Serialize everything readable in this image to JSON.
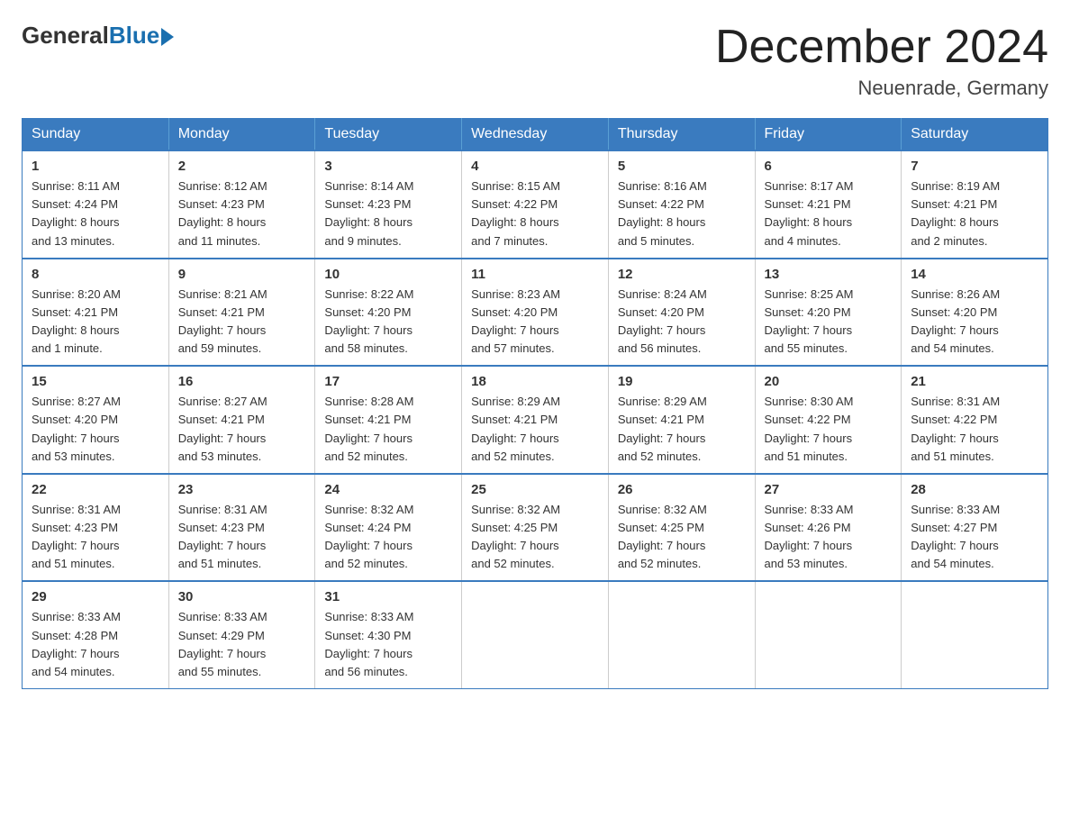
{
  "logo": {
    "general": "General",
    "blue": "Blue"
  },
  "title": "December 2024",
  "subtitle": "Neuenrade, Germany",
  "days_of_week": [
    "Sunday",
    "Monday",
    "Tuesday",
    "Wednesday",
    "Thursday",
    "Friday",
    "Saturday"
  ],
  "weeks": [
    [
      {
        "day": "1",
        "info": "Sunrise: 8:11 AM\nSunset: 4:24 PM\nDaylight: 8 hours\nand 13 minutes."
      },
      {
        "day": "2",
        "info": "Sunrise: 8:12 AM\nSunset: 4:23 PM\nDaylight: 8 hours\nand 11 minutes."
      },
      {
        "day": "3",
        "info": "Sunrise: 8:14 AM\nSunset: 4:23 PM\nDaylight: 8 hours\nand 9 minutes."
      },
      {
        "day": "4",
        "info": "Sunrise: 8:15 AM\nSunset: 4:22 PM\nDaylight: 8 hours\nand 7 minutes."
      },
      {
        "day": "5",
        "info": "Sunrise: 8:16 AM\nSunset: 4:22 PM\nDaylight: 8 hours\nand 5 minutes."
      },
      {
        "day": "6",
        "info": "Sunrise: 8:17 AM\nSunset: 4:21 PM\nDaylight: 8 hours\nand 4 minutes."
      },
      {
        "day": "7",
        "info": "Sunrise: 8:19 AM\nSunset: 4:21 PM\nDaylight: 8 hours\nand 2 minutes."
      }
    ],
    [
      {
        "day": "8",
        "info": "Sunrise: 8:20 AM\nSunset: 4:21 PM\nDaylight: 8 hours\nand 1 minute."
      },
      {
        "day": "9",
        "info": "Sunrise: 8:21 AM\nSunset: 4:21 PM\nDaylight: 7 hours\nand 59 minutes."
      },
      {
        "day": "10",
        "info": "Sunrise: 8:22 AM\nSunset: 4:20 PM\nDaylight: 7 hours\nand 58 minutes."
      },
      {
        "day": "11",
        "info": "Sunrise: 8:23 AM\nSunset: 4:20 PM\nDaylight: 7 hours\nand 57 minutes."
      },
      {
        "day": "12",
        "info": "Sunrise: 8:24 AM\nSunset: 4:20 PM\nDaylight: 7 hours\nand 56 minutes."
      },
      {
        "day": "13",
        "info": "Sunrise: 8:25 AM\nSunset: 4:20 PM\nDaylight: 7 hours\nand 55 minutes."
      },
      {
        "day": "14",
        "info": "Sunrise: 8:26 AM\nSunset: 4:20 PM\nDaylight: 7 hours\nand 54 minutes."
      }
    ],
    [
      {
        "day": "15",
        "info": "Sunrise: 8:27 AM\nSunset: 4:20 PM\nDaylight: 7 hours\nand 53 minutes."
      },
      {
        "day": "16",
        "info": "Sunrise: 8:27 AM\nSunset: 4:21 PM\nDaylight: 7 hours\nand 53 minutes."
      },
      {
        "day": "17",
        "info": "Sunrise: 8:28 AM\nSunset: 4:21 PM\nDaylight: 7 hours\nand 52 minutes."
      },
      {
        "day": "18",
        "info": "Sunrise: 8:29 AM\nSunset: 4:21 PM\nDaylight: 7 hours\nand 52 minutes."
      },
      {
        "day": "19",
        "info": "Sunrise: 8:29 AM\nSunset: 4:21 PM\nDaylight: 7 hours\nand 52 minutes."
      },
      {
        "day": "20",
        "info": "Sunrise: 8:30 AM\nSunset: 4:22 PM\nDaylight: 7 hours\nand 51 minutes."
      },
      {
        "day": "21",
        "info": "Sunrise: 8:31 AM\nSunset: 4:22 PM\nDaylight: 7 hours\nand 51 minutes."
      }
    ],
    [
      {
        "day": "22",
        "info": "Sunrise: 8:31 AM\nSunset: 4:23 PM\nDaylight: 7 hours\nand 51 minutes."
      },
      {
        "day": "23",
        "info": "Sunrise: 8:31 AM\nSunset: 4:23 PM\nDaylight: 7 hours\nand 51 minutes."
      },
      {
        "day": "24",
        "info": "Sunrise: 8:32 AM\nSunset: 4:24 PM\nDaylight: 7 hours\nand 52 minutes."
      },
      {
        "day": "25",
        "info": "Sunrise: 8:32 AM\nSunset: 4:25 PM\nDaylight: 7 hours\nand 52 minutes."
      },
      {
        "day": "26",
        "info": "Sunrise: 8:32 AM\nSunset: 4:25 PM\nDaylight: 7 hours\nand 52 minutes."
      },
      {
        "day": "27",
        "info": "Sunrise: 8:33 AM\nSunset: 4:26 PM\nDaylight: 7 hours\nand 53 minutes."
      },
      {
        "day": "28",
        "info": "Sunrise: 8:33 AM\nSunset: 4:27 PM\nDaylight: 7 hours\nand 54 minutes."
      }
    ],
    [
      {
        "day": "29",
        "info": "Sunrise: 8:33 AM\nSunset: 4:28 PM\nDaylight: 7 hours\nand 54 minutes."
      },
      {
        "day": "30",
        "info": "Sunrise: 8:33 AM\nSunset: 4:29 PM\nDaylight: 7 hours\nand 55 minutes."
      },
      {
        "day": "31",
        "info": "Sunrise: 8:33 AM\nSunset: 4:30 PM\nDaylight: 7 hours\nand 56 minutes."
      },
      {
        "day": "",
        "info": ""
      },
      {
        "day": "",
        "info": ""
      },
      {
        "day": "",
        "info": ""
      },
      {
        "day": "",
        "info": ""
      }
    ]
  ]
}
